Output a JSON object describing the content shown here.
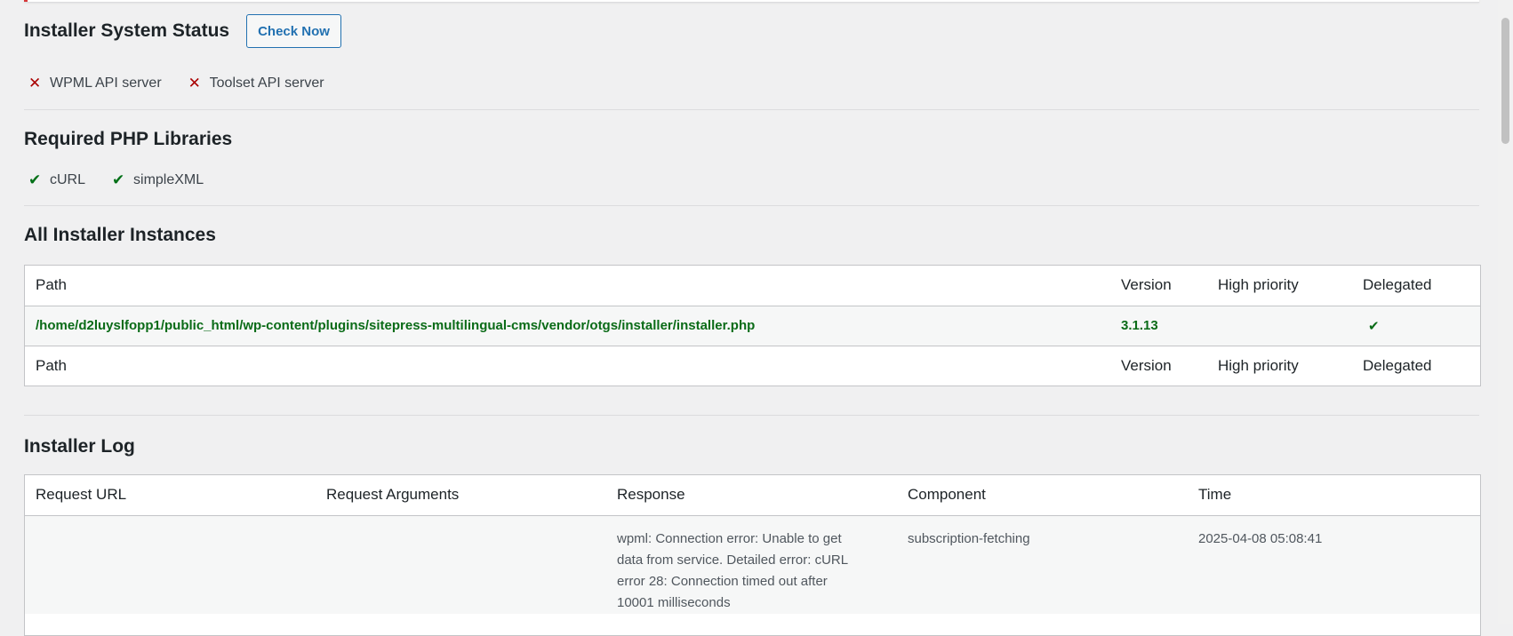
{
  "status": {
    "title": "Installer System Status",
    "check_button": "Check Now",
    "servers": [
      {
        "label": "WPML API server",
        "ok": false
      },
      {
        "label": "Toolset API server",
        "ok": false
      }
    ]
  },
  "libraries": {
    "title": "Required PHP Libraries",
    "items": [
      {
        "label": "cURL",
        "ok": true
      },
      {
        "label": "simpleXML",
        "ok": true
      }
    ]
  },
  "instances": {
    "title": "All Installer Instances",
    "columns": [
      "Path",
      "Version",
      "High priority",
      "Delegated"
    ],
    "rows": [
      {
        "path": "/home/d2luyslfopp1/public_html/wp-content/plugins/sitepress-multilingual-cms/vendor/otgs/installer/installer.php",
        "version": "3.1.13",
        "high_priority": "",
        "delegated": "✔"
      }
    ]
  },
  "log": {
    "title": "Installer Log",
    "columns": [
      "Request URL",
      "Request Arguments",
      "Response",
      "Component",
      "Time"
    ],
    "rows": [
      {
        "request_url": "",
        "request_arguments": "",
        "response": "wpml: Connection error: Unable to get data from service. Detailed error: cURL error 28: Connection timed out after 10001 milliseconds",
        "component": "subscription-fetching",
        "time": "2025-04-08 05:08:41"
      }
    ]
  },
  "colors": {
    "error": "#aa0000",
    "success": "#007017",
    "accent": "#2271b1"
  }
}
